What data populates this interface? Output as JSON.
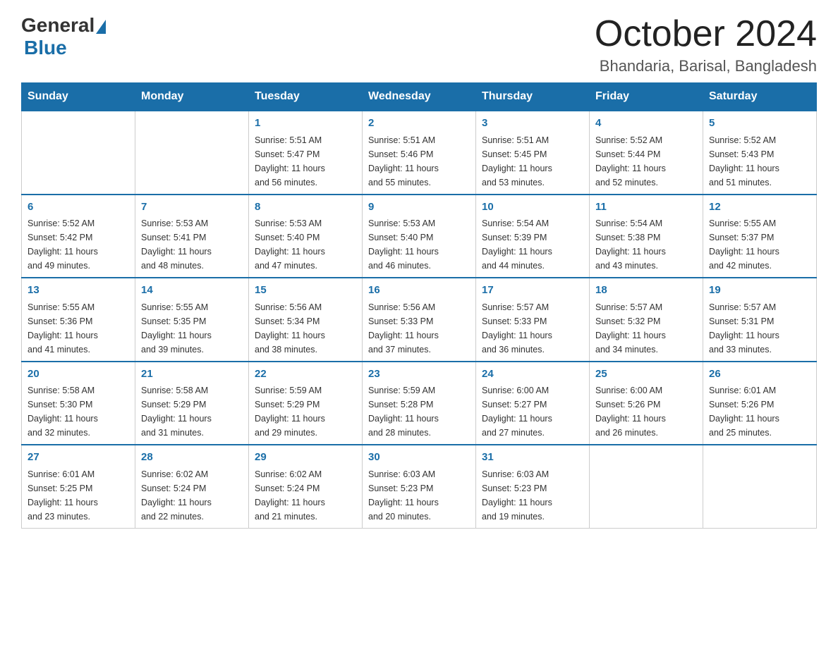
{
  "logo": {
    "general": "General",
    "blue": "Blue"
  },
  "header": {
    "month": "October 2024",
    "location": "Bhandaria, Barisal, Bangladesh"
  },
  "days_of_week": [
    "Sunday",
    "Monday",
    "Tuesday",
    "Wednesday",
    "Thursday",
    "Friday",
    "Saturday"
  ],
  "weeks": [
    [
      {
        "day": "",
        "info": ""
      },
      {
        "day": "",
        "info": ""
      },
      {
        "day": "1",
        "info": "Sunrise: 5:51 AM\nSunset: 5:47 PM\nDaylight: 11 hours\nand 56 minutes."
      },
      {
        "day": "2",
        "info": "Sunrise: 5:51 AM\nSunset: 5:46 PM\nDaylight: 11 hours\nand 55 minutes."
      },
      {
        "day": "3",
        "info": "Sunrise: 5:51 AM\nSunset: 5:45 PM\nDaylight: 11 hours\nand 53 minutes."
      },
      {
        "day": "4",
        "info": "Sunrise: 5:52 AM\nSunset: 5:44 PM\nDaylight: 11 hours\nand 52 minutes."
      },
      {
        "day": "5",
        "info": "Sunrise: 5:52 AM\nSunset: 5:43 PM\nDaylight: 11 hours\nand 51 minutes."
      }
    ],
    [
      {
        "day": "6",
        "info": "Sunrise: 5:52 AM\nSunset: 5:42 PM\nDaylight: 11 hours\nand 49 minutes."
      },
      {
        "day": "7",
        "info": "Sunrise: 5:53 AM\nSunset: 5:41 PM\nDaylight: 11 hours\nand 48 minutes."
      },
      {
        "day": "8",
        "info": "Sunrise: 5:53 AM\nSunset: 5:40 PM\nDaylight: 11 hours\nand 47 minutes."
      },
      {
        "day": "9",
        "info": "Sunrise: 5:53 AM\nSunset: 5:40 PM\nDaylight: 11 hours\nand 46 minutes."
      },
      {
        "day": "10",
        "info": "Sunrise: 5:54 AM\nSunset: 5:39 PM\nDaylight: 11 hours\nand 44 minutes."
      },
      {
        "day": "11",
        "info": "Sunrise: 5:54 AM\nSunset: 5:38 PM\nDaylight: 11 hours\nand 43 minutes."
      },
      {
        "day": "12",
        "info": "Sunrise: 5:55 AM\nSunset: 5:37 PM\nDaylight: 11 hours\nand 42 minutes."
      }
    ],
    [
      {
        "day": "13",
        "info": "Sunrise: 5:55 AM\nSunset: 5:36 PM\nDaylight: 11 hours\nand 41 minutes."
      },
      {
        "day": "14",
        "info": "Sunrise: 5:55 AM\nSunset: 5:35 PM\nDaylight: 11 hours\nand 39 minutes."
      },
      {
        "day": "15",
        "info": "Sunrise: 5:56 AM\nSunset: 5:34 PM\nDaylight: 11 hours\nand 38 minutes."
      },
      {
        "day": "16",
        "info": "Sunrise: 5:56 AM\nSunset: 5:33 PM\nDaylight: 11 hours\nand 37 minutes."
      },
      {
        "day": "17",
        "info": "Sunrise: 5:57 AM\nSunset: 5:33 PM\nDaylight: 11 hours\nand 36 minutes."
      },
      {
        "day": "18",
        "info": "Sunrise: 5:57 AM\nSunset: 5:32 PM\nDaylight: 11 hours\nand 34 minutes."
      },
      {
        "day": "19",
        "info": "Sunrise: 5:57 AM\nSunset: 5:31 PM\nDaylight: 11 hours\nand 33 minutes."
      }
    ],
    [
      {
        "day": "20",
        "info": "Sunrise: 5:58 AM\nSunset: 5:30 PM\nDaylight: 11 hours\nand 32 minutes."
      },
      {
        "day": "21",
        "info": "Sunrise: 5:58 AM\nSunset: 5:29 PM\nDaylight: 11 hours\nand 31 minutes."
      },
      {
        "day": "22",
        "info": "Sunrise: 5:59 AM\nSunset: 5:29 PM\nDaylight: 11 hours\nand 29 minutes."
      },
      {
        "day": "23",
        "info": "Sunrise: 5:59 AM\nSunset: 5:28 PM\nDaylight: 11 hours\nand 28 minutes."
      },
      {
        "day": "24",
        "info": "Sunrise: 6:00 AM\nSunset: 5:27 PM\nDaylight: 11 hours\nand 27 minutes."
      },
      {
        "day": "25",
        "info": "Sunrise: 6:00 AM\nSunset: 5:26 PM\nDaylight: 11 hours\nand 26 minutes."
      },
      {
        "day": "26",
        "info": "Sunrise: 6:01 AM\nSunset: 5:26 PM\nDaylight: 11 hours\nand 25 minutes."
      }
    ],
    [
      {
        "day": "27",
        "info": "Sunrise: 6:01 AM\nSunset: 5:25 PM\nDaylight: 11 hours\nand 23 minutes."
      },
      {
        "day": "28",
        "info": "Sunrise: 6:02 AM\nSunset: 5:24 PM\nDaylight: 11 hours\nand 22 minutes."
      },
      {
        "day": "29",
        "info": "Sunrise: 6:02 AM\nSunset: 5:24 PM\nDaylight: 11 hours\nand 21 minutes."
      },
      {
        "day": "30",
        "info": "Sunrise: 6:03 AM\nSunset: 5:23 PM\nDaylight: 11 hours\nand 20 minutes."
      },
      {
        "day": "31",
        "info": "Sunrise: 6:03 AM\nSunset: 5:23 PM\nDaylight: 11 hours\nand 19 minutes."
      },
      {
        "day": "",
        "info": ""
      },
      {
        "day": "",
        "info": ""
      }
    ]
  ]
}
